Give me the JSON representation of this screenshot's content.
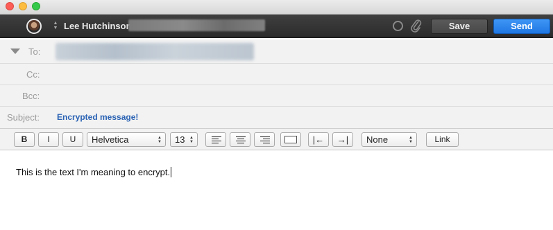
{
  "window": {
    "traffic_lights": [
      "close",
      "minimize",
      "maximize"
    ]
  },
  "header": {
    "from_name": "Lee Hutchinson",
    "save_label": "Save",
    "send_label": "Send",
    "send_color": "#1f77e3"
  },
  "fields": {
    "to_label": "To:",
    "cc_label": "Cc:",
    "bcc_label": "Bcc:",
    "subject_label": "Subject:",
    "subject_value": "Encrypted message!"
  },
  "toolbar": {
    "bold": "B",
    "italic": "I",
    "underline": "U",
    "font": "Helvetica",
    "size": "13",
    "list": "None",
    "link": "Link"
  },
  "body": {
    "text": "This is the text I'm meaning to encrypt."
  }
}
